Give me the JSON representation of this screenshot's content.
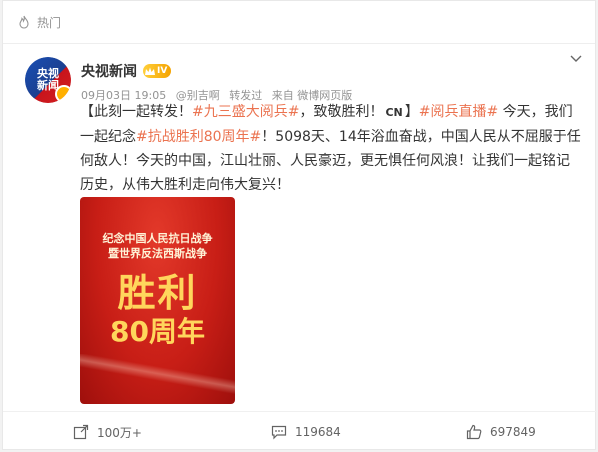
{
  "hot_bar": {
    "label": "热门"
  },
  "post": {
    "user_name": "央视新闻",
    "avatar_text": [
      "央视",
      "新闻"
    ],
    "vip_level": "IV",
    "time": "09月03日 19:05",
    "via_user": "@别吉啊",
    "repost_word": "转发过",
    "source": "来自 微博网页版",
    "content": {
      "part1": "【此刻一起转发！",
      "topic1": "#九三盛大阅兵#",
      "part2": "，致敬胜利！",
      "cn_mark": "CN",
      "part3": "】",
      "topic2": "#阅兵直播#",
      "part4": " 今天，我们一起纪念",
      "topic3": "#抗战胜利80周年#",
      "part5": "！5098天、14年浴血奋战，中国人民从不屈服于任何敌人！今天的中国，江山壮丽、人民豪迈，更无惧任何风浪！让我们一起铭记历史，从伟大胜利走向伟大复兴！"
    },
    "poster": {
      "line1": "纪念中国人民抗日战争",
      "line2": "暨世界反法西斯战争",
      "big": "胜利",
      "years": "80周年"
    }
  },
  "actions": {
    "repost_count": "100万+",
    "comment_count": "119684",
    "like_count": "697849"
  },
  "colors": {
    "topic": "#eb7350",
    "poster_red": "#c81e16",
    "poster_gold": "#ffd65c"
  }
}
